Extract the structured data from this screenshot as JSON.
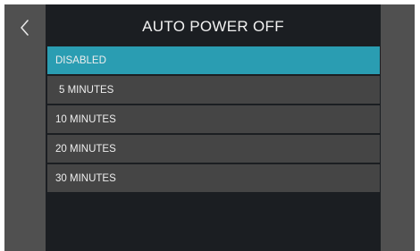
{
  "header": {
    "title": "AUTO POWER OFF",
    "back_icon": "chevron-left-icon"
  },
  "colors": {
    "selected": "#2a9db2",
    "item_bg": "#454545",
    "main_bg": "#1b1e22",
    "side_bg": "#505050"
  },
  "options": {
    "selected_index": 0,
    "items": [
      {
        "label": "DISABLED"
      },
      {
        "label": "5 MINUTES"
      },
      {
        "label": "10 MINUTES"
      },
      {
        "label": "20 MINUTES"
      },
      {
        "label": "30 MINUTES"
      }
    ]
  }
}
